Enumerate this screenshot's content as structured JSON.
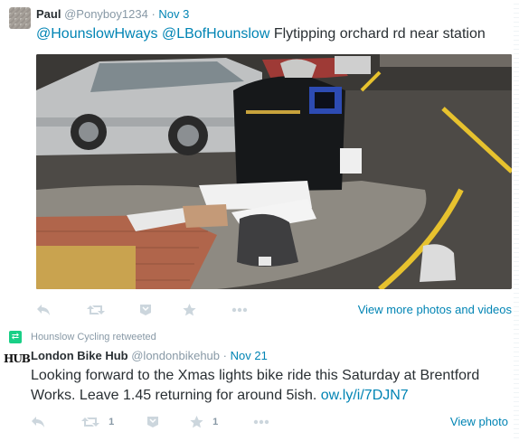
{
  "tweet1": {
    "name": "Paul",
    "handle": "@Ponyboy1234",
    "separator": "·",
    "date": "Nov 3",
    "mention1": "@HounslowHways",
    "mention2": "@LBofHounslow",
    "text": "Flytipping orchard rd near station",
    "view_more": "View more photos and videos"
  },
  "tweet2": {
    "retweeted_by": "Hounslow Cycling retweeted",
    "avatar_text": "HUB",
    "name": "London Bike Hub",
    "handle": "@londonbikehub",
    "separator": "·",
    "date": "Nov 21",
    "text": "Looking forward to the Xmas lights bike ride this Saturday at Brentford Works. Leave 1.45 returning for around 5ish.",
    "link": "ow.ly/i/7DJN7",
    "retweet_count": "1",
    "like_count": "1",
    "view_photo": "View photo"
  },
  "icons": {
    "reply": "reply-icon",
    "retweet": "retweet-icon",
    "dm": "direct-message-icon",
    "like": "star-icon",
    "more": "more-dots-icon"
  },
  "colors": {
    "link": "#0084b4",
    "muted": "#8899a6",
    "action": "#ccd6dd",
    "retweet_green": "#19cf86"
  }
}
